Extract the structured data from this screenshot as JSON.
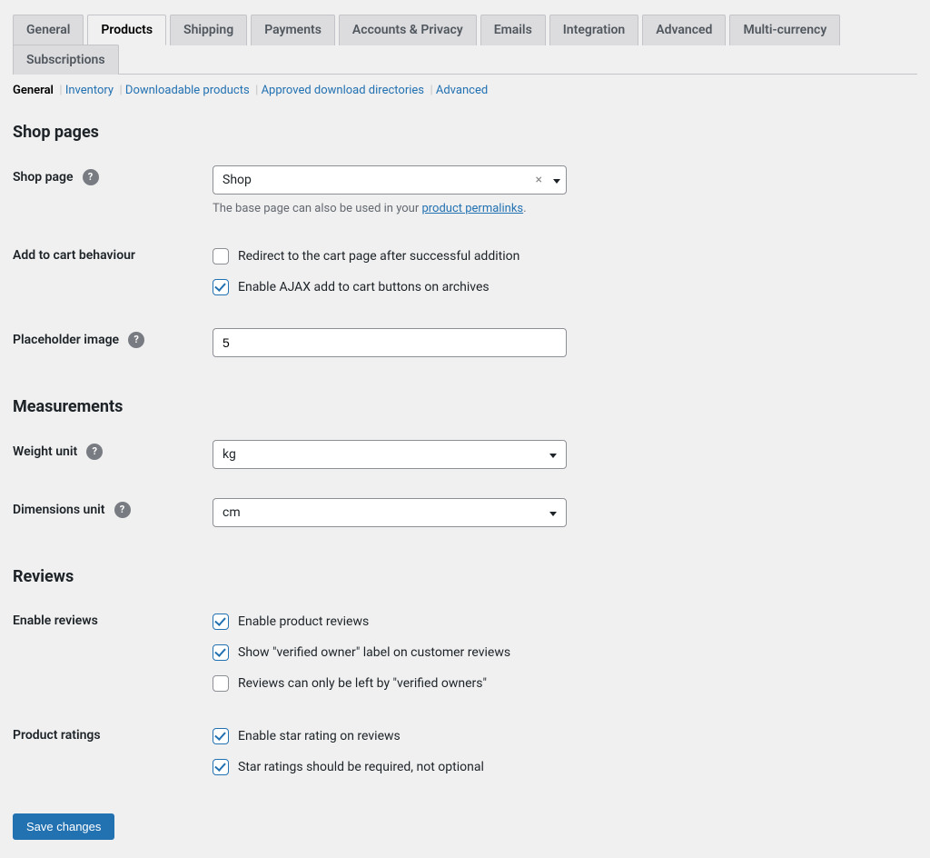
{
  "tabs": [
    {
      "id": "general",
      "label": "General"
    },
    {
      "id": "products",
      "label": "Products",
      "active": true
    },
    {
      "id": "shipping",
      "label": "Shipping"
    },
    {
      "id": "payments",
      "label": "Payments"
    },
    {
      "id": "accounts",
      "label": "Accounts & Privacy"
    },
    {
      "id": "emails",
      "label": "Emails"
    },
    {
      "id": "integration",
      "label": "Integration"
    },
    {
      "id": "advanced",
      "label": "Advanced"
    },
    {
      "id": "multicurrency",
      "label": "Multi-currency"
    },
    {
      "id": "subscriptions",
      "label": "Subscriptions"
    }
  ],
  "subtabs": [
    {
      "id": "general",
      "label": "General",
      "current": true
    },
    {
      "id": "inventory",
      "label": "Inventory"
    },
    {
      "id": "downloadable",
      "label": "Downloadable products"
    },
    {
      "id": "approved",
      "label": "Approved download directories"
    },
    {
      "id": "advanced",
      "label": "Advanced"
    }
  ],
  "sections": {
    "shop_pages": "Shop pages",
    "measurements": "Measurements",
    "reviews": "Reviews"
  },
  "fields": {
    "shop_page": {
      "label": "Shop page",
      "value": "Shop",
      "desc_prefix": "The base page can also be used in your ",
      "desc_link": "product permalinks",
      "desc_suffix": "."
    },
    "add_to_cart": {
      "label": "Add to cart behaviour",
      "opt_redirect": "Redirect to the cart page after successful addition",
      "opt_ajax": "Enable AJAX add to cart buttons on archives"
    },
    "placeholder": {
      "label": "Placeholder image",
      "value": "5"
    },
    "weight_unit": {
      "label": "Weight unit",
      "value": "kg"
    },
    "dimensions_unit": {
      "label": "Dimensions unit",
      "value": "cm"
    },
    "enable_reviews": {
      "label": "Enable reviews",
      "opt_enable": "Enable product reviews",
      "opt_verified_label": "Show \"verified owner\" label on customer reviews",
      "opt_verified_only": "Reviews can only be left by \"verified owners\""
    },
    "product_ratings": {
      "label": "Product ratings",
      "opt_star": "Enable star rating on reviews",
      "opt_required": "Star ratings should be required, not optional"
    }
  },
  "checkbox_state": {
    "redirect": false,
    "ajax": true,
    "enable_product_reviews": true,
    "verified_label": true,
    "verified_only": false,
    "star_rating": true,
    "star_required": true
  },
  "buttons": {
    "save": "Save changes"
  }
}
